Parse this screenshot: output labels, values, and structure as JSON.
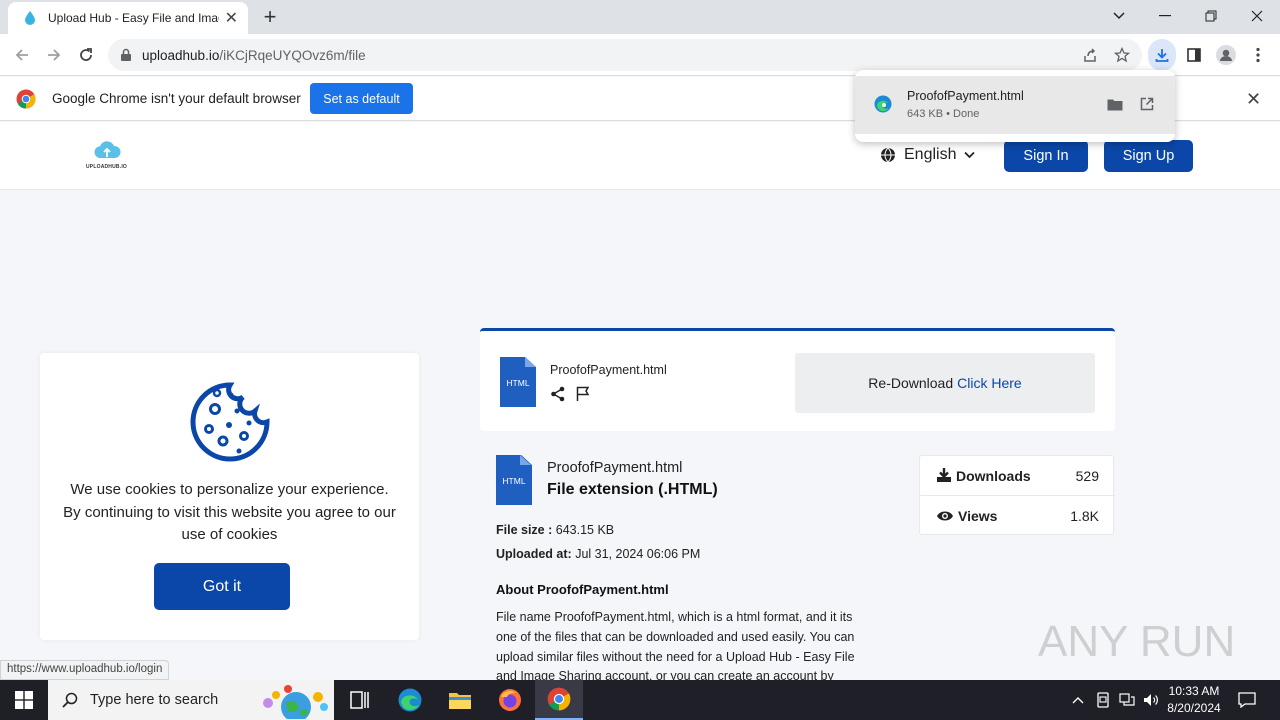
{
  "browser": {
    "tab_title": "Upload Hub - Easy File and Imag",
    "url_domain": "uploadhub.io",
    "url_path": "/iKCjRqeUYQOvz6m/file"
  },
  "infobar": {
    "message": "Google Chrome isn't your default browser",
    "button": "Set as default"
  },
  "download": {
    "filename": "ProofofPayment.html",
    "status": "643 KB • Done"
  },
  "header": {
    "logo_text": "UPLOADHUB.IO",
    "language": "English",
    "signin": "Sign In",
    "signup": "Sign Up"
  },
  "cookie": {
    "text": "We use cookies to personalize your experience. By continuing to visit this website you agree to our use of cookies",
    "button": "Got it"
  },
  "file_panel": {
    "icon_label": "HTML",
    "name": "ProofofPayment.html",
    "redownload_text": "Re-Download",
    "redownload_link": "Click Here"
  },
  "details": {
    "icon_label": "HTML",
    "name": "ProofofPayment.html",
    "extension": "File extension (.HTML)",
    "size_label": "File size :",
    "size_value": "643.15 KB",
    "uploaded_label": "Uploaded at:",
    "uploaded_value": "Jul 31, 2024 06:06 PM",
    "about_heading": "About ProofofPayment.html",
    "about_text": "File name ProofofPayment.html, which is a html format, and it its one of the files that can be downloaded and used easily. You can upload similar files without the need for a Upload Hub - Easy File and Image Sharing account, or you can create an account by"
  },
  "stats": {
    "downloads_label": "Downloads",
    "downloads_value": "529",
    "views_label": "Views",
    "views_value": "1.8K"
  },
  "status_url": "https://www.uploadhub.io/login",
  "watermark": "ANY RUN",
  "taskbar": {
    "search_placeholder": "Type here to search",
    "time": "10:33 AM",
    "date": "8/20/2024"
  },
  "colors": {
    "brand_blue": "#0b47a8",
    "chrome_blue": "#1a73e8"
  }
}
